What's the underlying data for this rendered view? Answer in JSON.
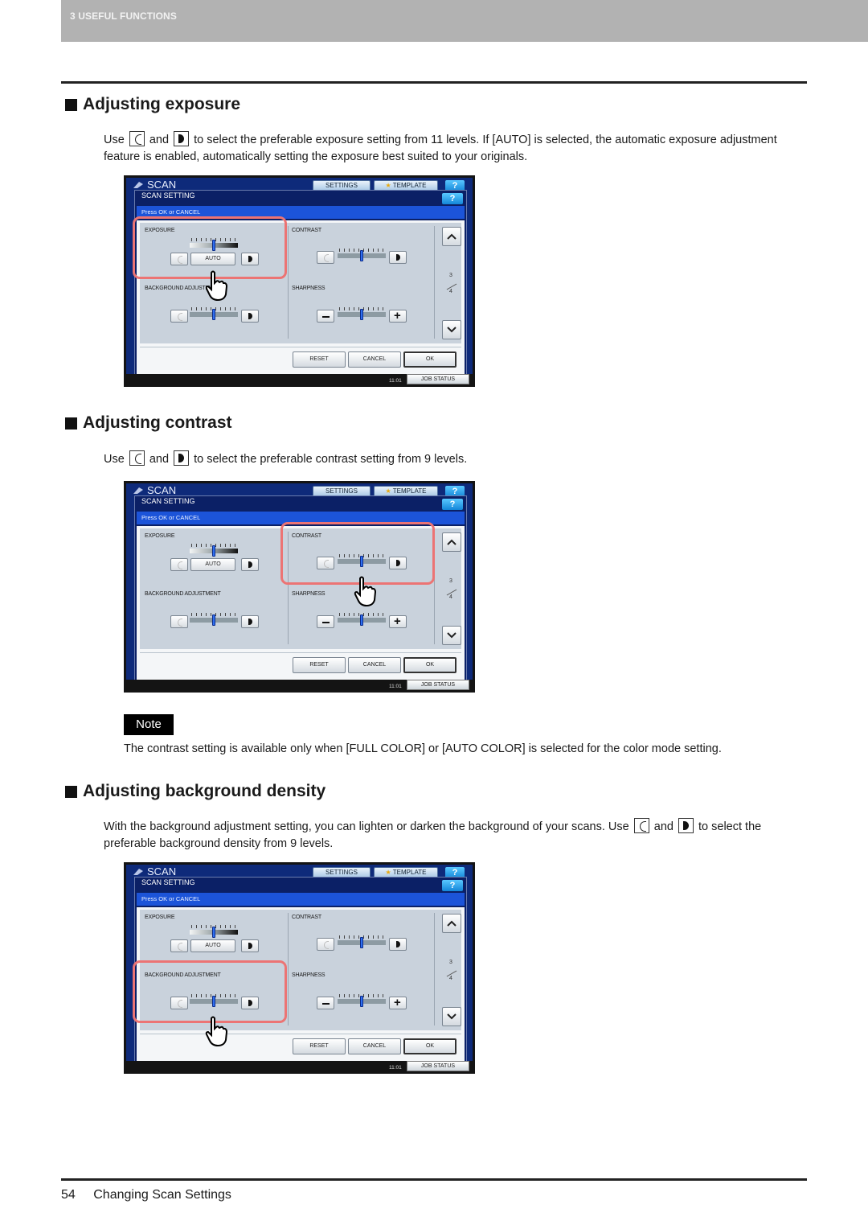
{
  "header": {
    "chapter": "3 USEFUL FUNCTIONS"
  },
  "sections": [
    {
      "heading": "Adjusting exposure",
      "paragraph": {
        "before_light": "Use",
        "between": "and",
        "after_dark": "to select the preferable exposure setting from 11 levels. If [AUTO] is selected, the automatic exposure adjustment feature is enabled, automatically setting the exposure best suited to your originals."
      },
      "highlight": "exposure"
    },
    {
      "heading": "Adjusting contrast",
      "paragraph": {
        "before_light": "Use",
        "between": "and",
        "after_dark": "to select the preferable contrast setting from 9 levels."
      },
      "highlight": "contrast"
    },
    {
      "heading": "Adjusting background density",
      "paragraph": {
        "before_light": "With the background adjustment setting, you can lighten or darken the background of your scans. Use",
        "between": "and",
        "after_dark": "to select the preferable background density from 9 levels."
      },
      "highlight": "background"
    }
  ],
  "note": {
    "label": "Note",
    "text": "The contrast setting is available only when [FULL COLOR] or [AUTO COLOR] is selected for the color mode setting."
  },
  "panel": {
    "app_title": "SCAN",
    "tab_settings": "SETTINGS",
    "tab_template": "TEMPLATE",
    "help": "?",
    "dialog_title": "SCAN SETTING",
    "message": "Press OK or CANCEL",
    "groups": {
      "exposure": "EXPOSURE",
      "contrast": "CONTRAST",
      "background": "BACKGROUND ADJUSTMENT",
      "sharpness": "SHARPNESS"
    },
    "auto_label": "AUTO",
    "page_current": "3",
    "page_total": "4",
    "reset": "RESET",
    "cancel": "CANCEL",
    "ok": "OK",
    "clock": "11:01",
    "job_status": "JOB STATUS",
    "slider_levels": {
      "exposure": {
        "value": 6,
        "of": 11
      },
      "contrast": {
        "value": 5,
        "of": 9
      },
      "background": {
        "value": 5,
        "of": 9
      },
      "sharpness": {
        "value": 5,
        "of": 9
      }
    }
  },
  "footer": {
    "page_number": "54",
    "title": "Changing Scan Settings"
  }
}
